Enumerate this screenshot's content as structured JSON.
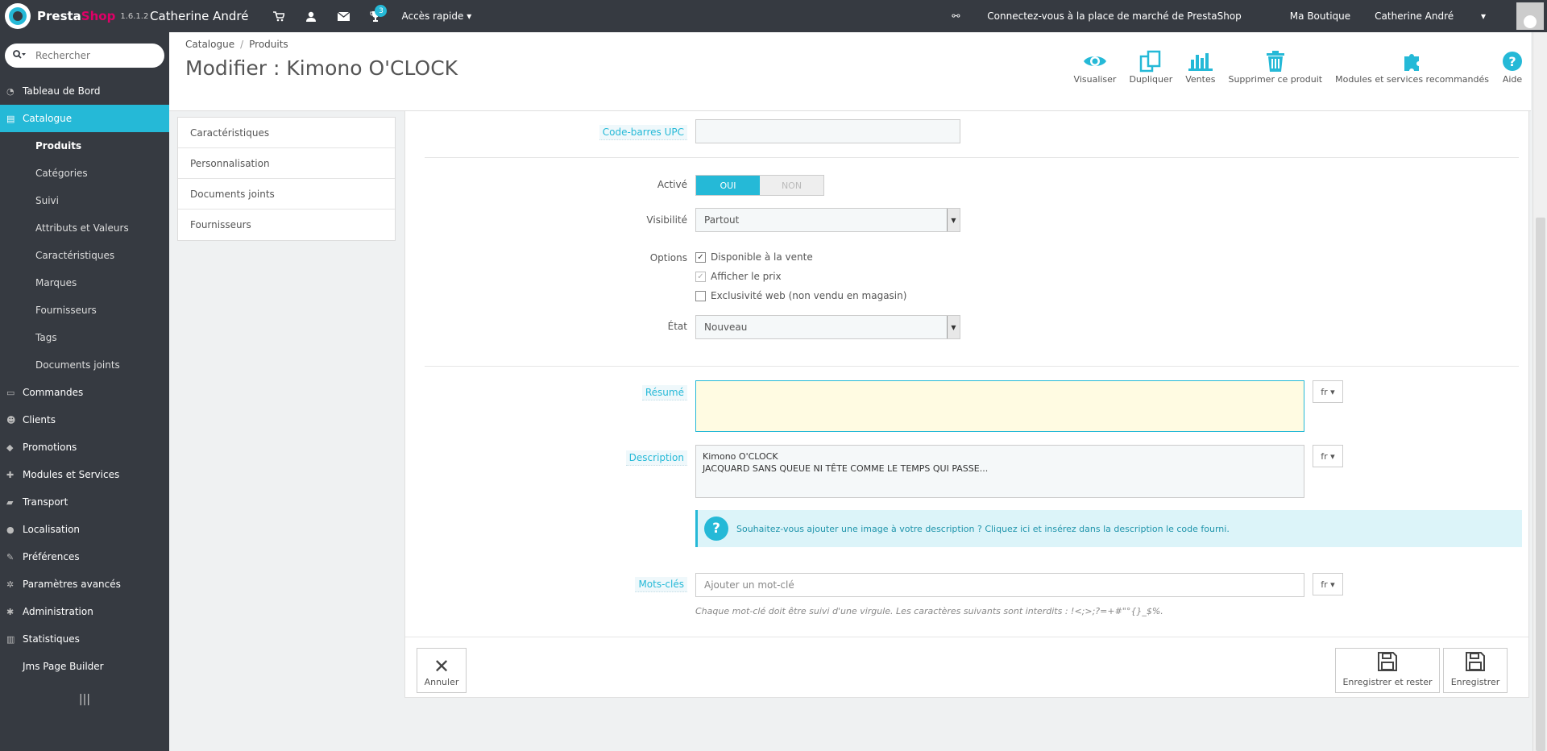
{
  "topbar": {
    "brand_a": "Presta",
    "brand_b": "Shop",
    "version": "1.6.1.2",
    "shop_name": "Catherine André",
    "notif_count": "3",
    "quick_access": "Accès rapide",
    "marketplace": "Connectez-vous à la place de marché de PrestaShop",
    "store": "Ma Boutique",
    "user": "Catherine André"
  },
  "sidebar": {
    "search_placeholder": "Rechercher",
    "items": [
      {
        "label": "Tableau de Bord",
        "icon": "dashboard-icon"
      },
      {
        "label": "Catalogue",
        "icon": "book-icon"
      },
      {
        "label": "Commandes",
        "icon": "credit-card-icon"
      },
      {
        "label": "Clients",
        "icon": "users-icon"
      },
      {
        "label": "Promotions",
        "icon": "tag-icon"
      },
      {
        "label": "Modules et Services",
        "icon": "puzzle-icon"
      },
      {
        "label": "Transport",
        "icon": "truck-icon"
      },
      {
        "label": "Localisation",
        "icon": "globe-icon"
      },
      {
        "label": "Préférences",
        "icon": "wrench-icon"
      },
      {
        "label": "Paramètres avancés",
        "icon": "cogs-icon"
      },
      {
        "label": "Administration",
        "icon": "gear-icon"
      },
      {
        "label": "Statistiques",
        "icon": "bar-chart-icon"
      },
      {
        "label": "Jms Page Builder",
        "icon": ""
      }
    ],
    "sub_items": [
      "Produits",
      "Catégories",
      "Suivi",
      "Attributs et Valeurs",
      "Caractéristiques",
      "Marques",
      "Fournisseurs",
      "Tags",
      "Documents joints"
    ]
  },
  "header": {
    "breadcrumb": [
      "Catalogue",
      "Produits"
    ],
    "title": "Modifier : Kimono O'CLOCK",
    "toolbar": [
      "Visualiser",
      "Dupliquer",
      "Ventes",
      "Supprimer ce produit",
      "Modules et services recommandés",
      "Aide"
    ]
  },
  "tabs": [
    "Caractéristiques",
    "Personnalisation",
    "Documents joints",
    "Fournisseurs"
  ],
  "form": {
    "upc_label": "Code-barres UPC",
    "upc_value": "",
    "active_label": "Activé",
    "active_on": "OUI",
    "active_off": "NON",
    "visibility_label": "Visibilité",
    "visibility_value": "Partout",
    "options_label": "Options",
    "options": [
      "Disponible à la vente",
      "Afficher le prix",
      "Exclusivité web (non vendu en magasin)"
    ],
    "state_label": "État",
    "state_value": "Nouveau",
    "summary_label": "Résumé",
    "summary_value": "",
    "lang": "fr",
    "description_label": "Description",
    "description_line1": "Kimono O'CLOCK",
    "description_line2": "JACQUARD SANS QUEUE NI TÊTE COMME LE TEMPS QUI PASSE...",
    "alert_text_a": "Souhaitez-vous ajouter une image à votre description ? ",
    "alert_link": "Cliquez ici",
    "alert_text_b": " et insérez dans la description le code fourni.",
    "keywords_label": "Mots-clés",
    "keywords_placeholder": "Ajouter un mot-clé",
    "keywords_help": "Chaque mot-clé doit être suivi d'une virgule. Les caractères suivants sont interdits : !<;>;?=+#\"°{}_$%.",
    "cancel": "Annuler",
    "save_stay": "Enregistrer et rester",
    "save": "Enregistrer"
  },
  "colors": {
    "accent": "#25b9d7",
    "dark": "#363a41",
    "brand_pink": "#df0067"
  }
}
